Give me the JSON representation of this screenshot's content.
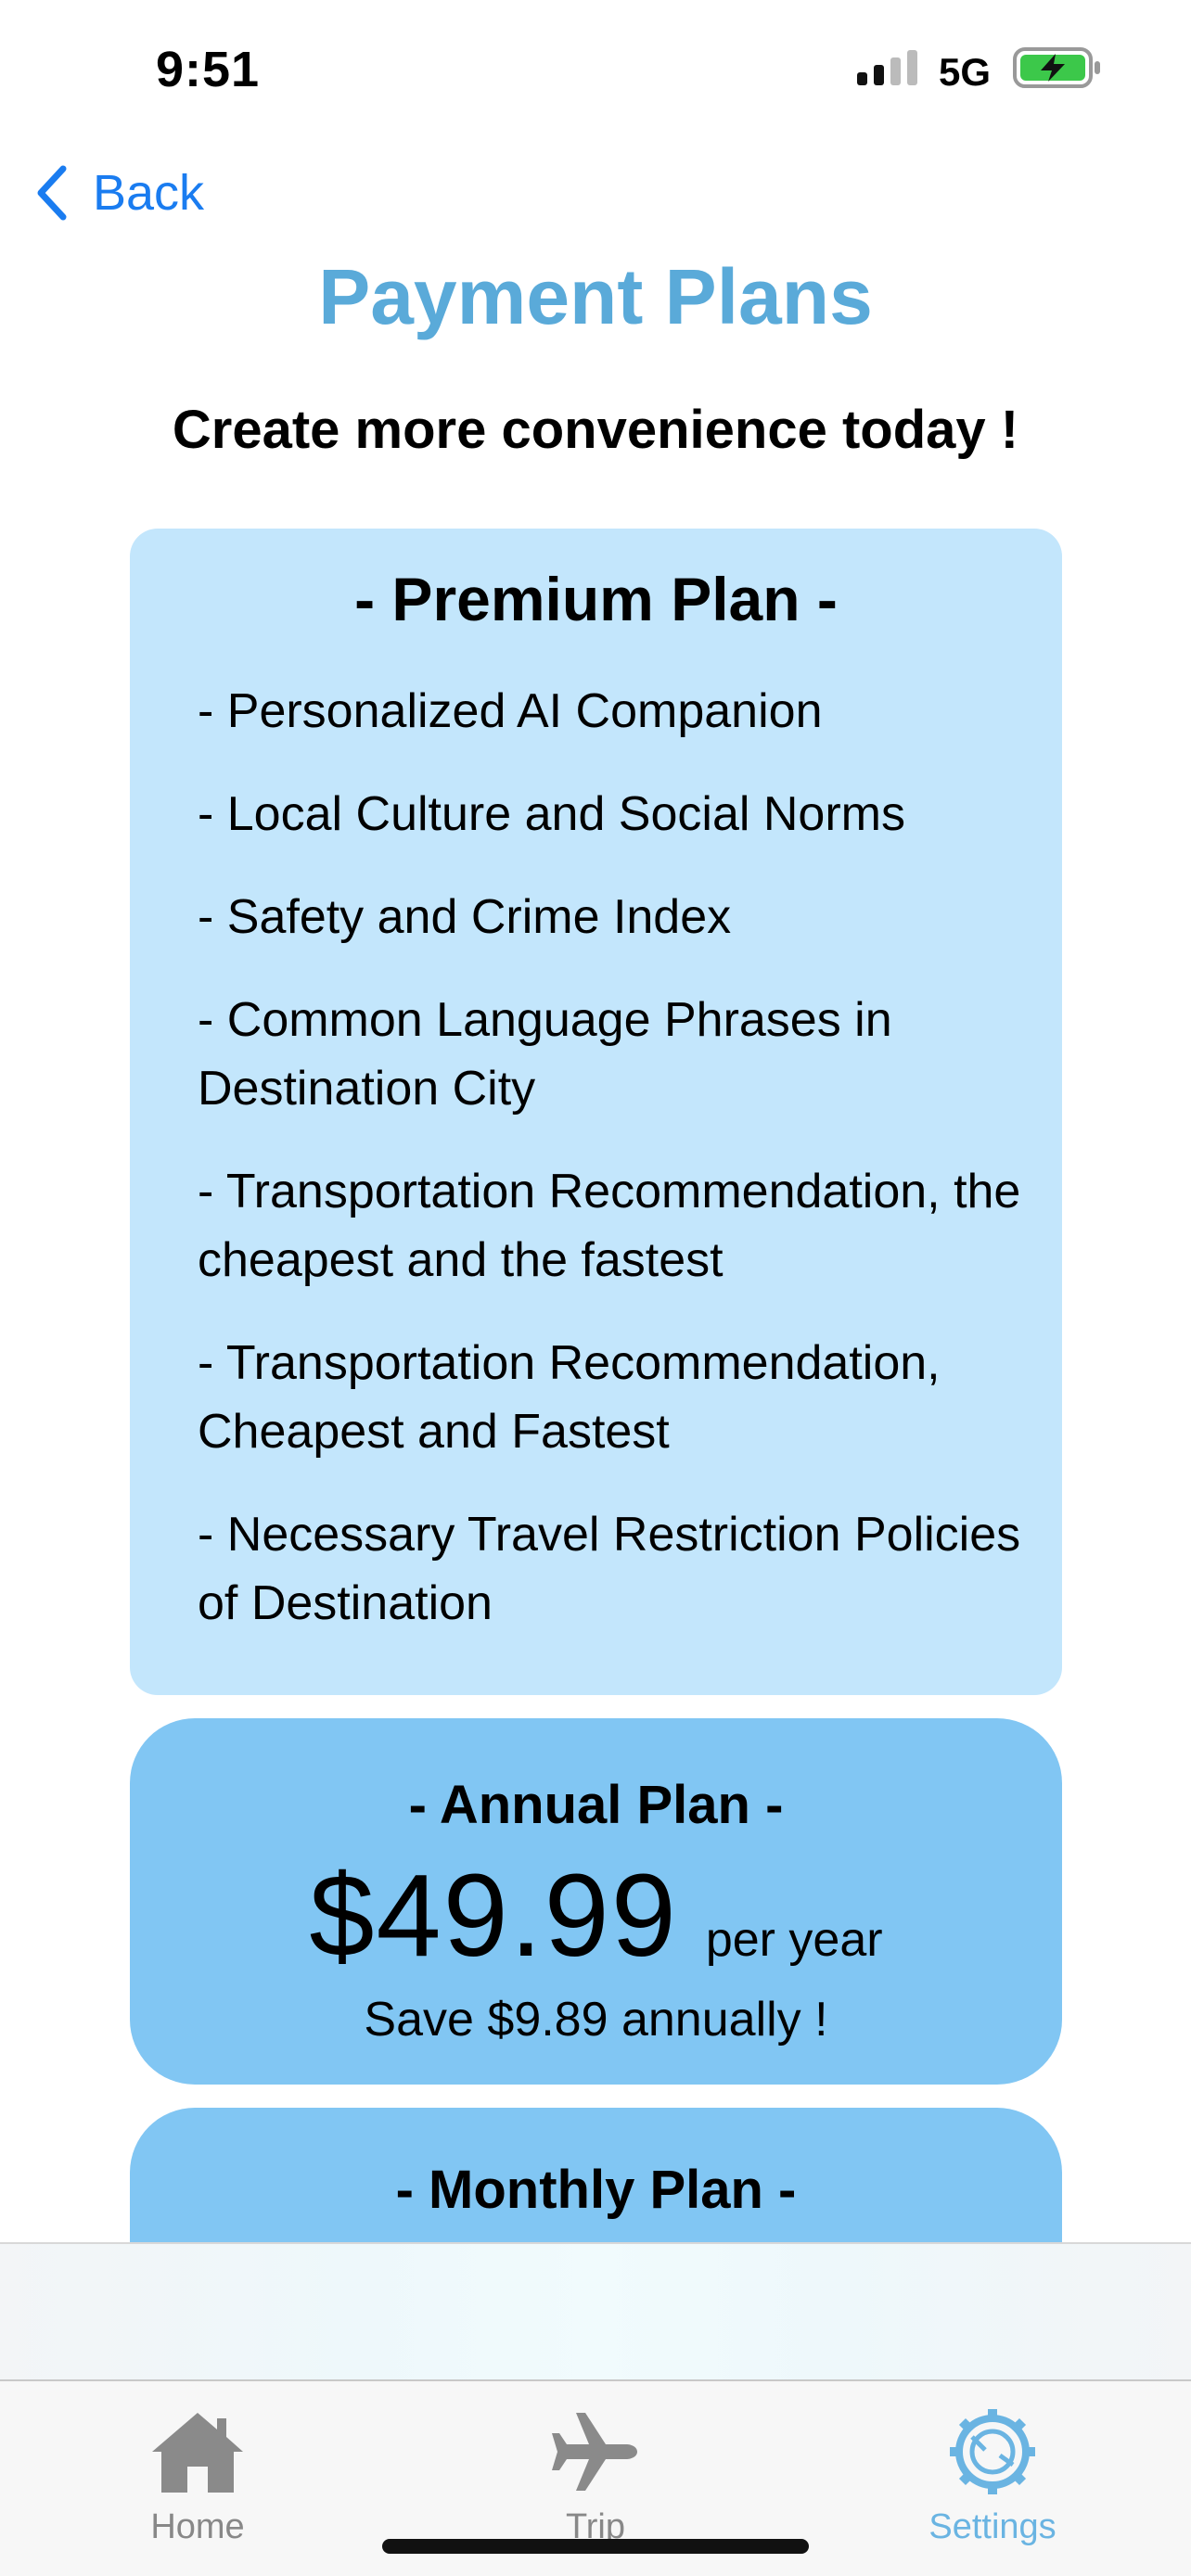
{
  "status_bar": {
    "time": "9:51",
    "network": "5G",
    "icons": [
      "signal-icon",
      "battery-charging-icon"
    ]
  },
  "nav": {
    "back_label": "Back"
  },
  "header": {
    "title": "Payment Plans",
    "subtitle": "Create more convenience today !"
  },
  "premium_plan": {
    "title": "- Premium Plan -",
    "features": [
      "- Personalized AI Companion",
      "- Local Culture and Social Norms",
      "- Safety and Crime Index",
      "- Common Language Phrases in Destination City",
      "- Transportation Recommendation, the cheapest and the fastest",
      "- Transportation Recommendation, Cheapest and Fastest",
      "- Necessary Travel Restriction Policies of Destination"
    ]
  },
  "annual_plan": {
    "title": "- Annual Plan -",
    "price": "$49.99",
    "unit": "per year",
    "savings": "Save $9.89 annually !"
  },
  "monthly_plan": {
    "title": "- Monthly Plan -"
  },
  "tab_bar": {
    "tabs": [
      {
        "label": "Home",
        "icon": "home-icon"
      },
      {
        "label": "Trip",
        "icon": "airplane-icon"
      },
      {
        "label": "Settings",
        "icon": "gear-icon",
        "active": true
      }
    ]
  },
  "colors": {
    "accent_title": "#5aaad9",
    "link_blue": "#1a7cf0",
    "premium_card": "#c3e6fc",
    "plan_card": "#81c6f3",
    "active_tab": "#6ab4e2",
    "inactive_tab": "#888888"
  }
}
